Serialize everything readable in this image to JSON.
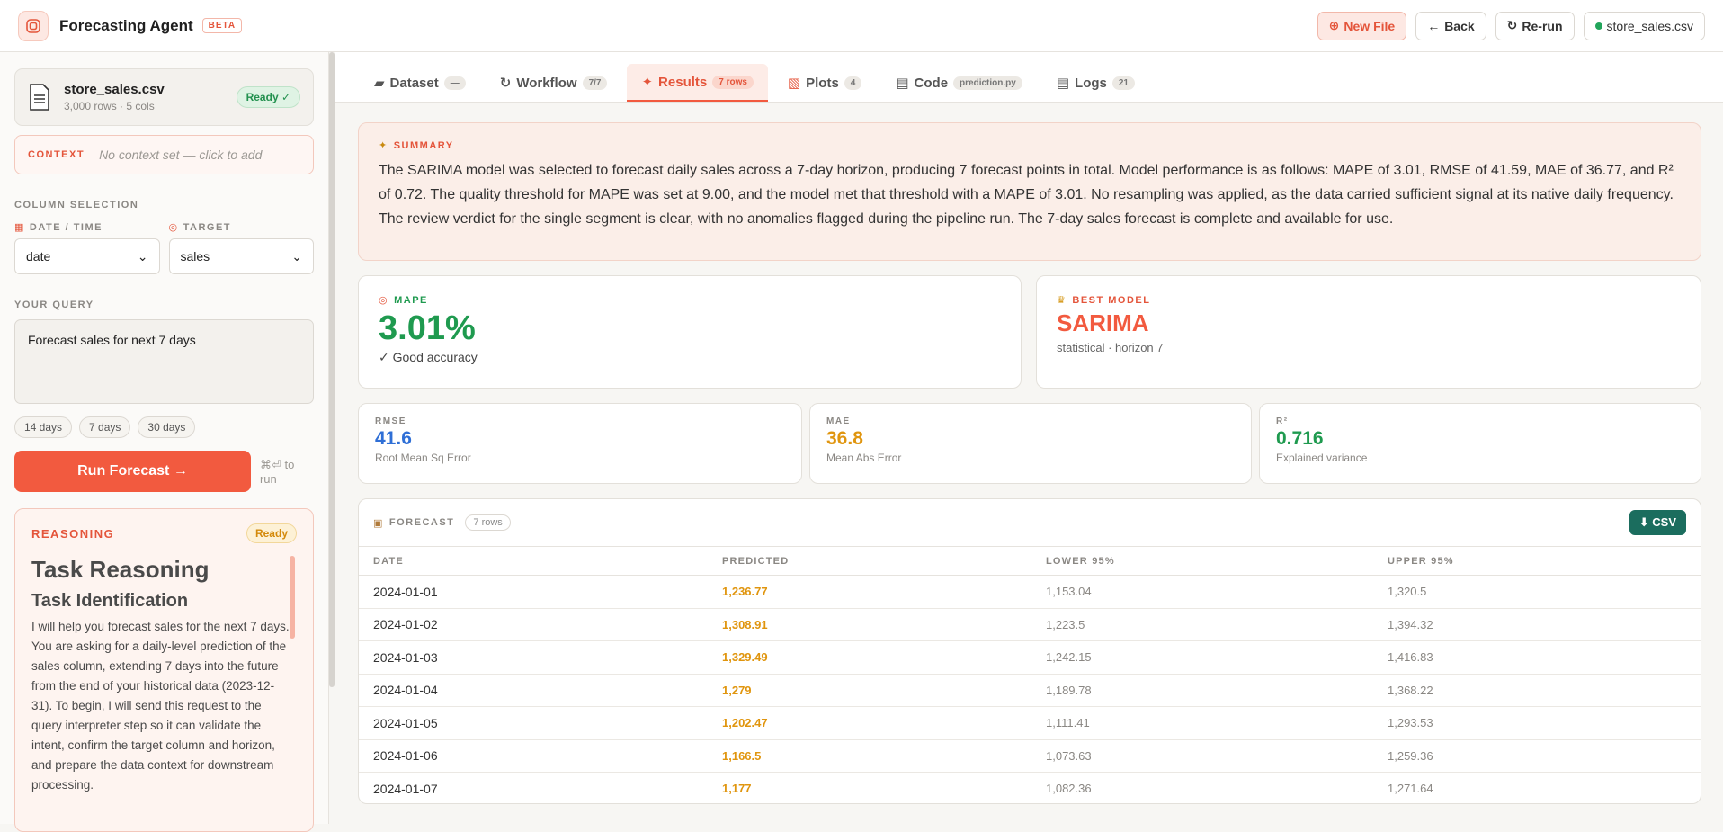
{
  "app": {
    "title": "Forecasting Agent",
    "badge": "BETA",
    "actions": {
      "new_file": "New File",
      "back": "Back",
      "rerun": "Re-run",
      "file": "store_sales.csv"
    }
  },
  "sidebar": {
    "file": {
      "name": "store_sales.csv",
      "meta": "3,000 rows · 5 cols",
      "status": "Ready ✓"
    },
    "context": {
      "label": "CONTEXT",
      "placeholder": "No context set — click to add"
    },
    "column_selection": {
      "label": "COLUMN SELECTION",
      "date_label": "DATE / TIME",
      "date_value": "date",
      "target_label": "TARGET",
      "target_value": "sales"
    },
    "query": {
      "label": "YOUR QUERY",
      "value": "Forecast sales for next 7 days",
      "chips": [
        "14 days",
        "7 days",
        "30 days"
      ]
    },
    "run": {
      "label": "Run Forecast →",
      "hint": "⌘⏎ to run"
    },
    "reasoning": {
      "label": "REASONING",
      "status": "Ready",
      "title": "Task Reasoning",
      "subtitle": "Task Identification",
      "body": "I will help you forecast sales for the next 7 days. You are asking for a daily-level prediction of the sales column, extending 7 days into the future from the end of your historical data (2023-12-31). To begin, I will send this request to the query interpreter step so it can validate the intent, confirm the target column and horizon, and prepare the data context for downstream processing."
    }
  },
  "tabs": [
    {
      "label": "Dataset",
      "count": "—"
    },
    {
      "label": "Workflow",
      "count": "7/7"
    },
    {
      "label": "Results",
      "count": "7 rows"
    },
    {
      "label": "Plots",
      "count": "4"
    },
    {
      "label": "Code",
      "count": "prediction.py"
    },
    {
      "label": "Logs",
      "count": "21"
    }
  ],
  "summary": {
    "label": "SUMMARY",
    "text": "The SARIMA model was selected to forecast daily sales across a 7-day horizon, producing 7 forecast points in total. Model performance is as follows: MAPE of 3.01, RMSE of 41.59, MAE of 36.77, and R² of 0.72. The quality threshold for MAPE was set at 9.00, and the model met that threshold with a MAPE of 3.01. No resampling was applied, as the data carried sufficient signal at its native daily frequency. The review verdict for the single segment is clear, with no anomalies flagged during the pipeline run. The 7-day sales forecast is complete and available for use."
  },
  "metrics": {
    "mape": {
      "label": "MAPE",
      "value": "3.01%",
      "note": "✓ Good accuracy"
    },
    "best_model": {
      "label": "BEST MODEL",
      "value": "SARIMA",
      "note": "statistical · horizon 7"
    },
    "rmse": {
      "label": "RMSE",
      "value": "41.6",
      "note": "Root Mean Sq Error"
    },
    "mae": {
      "label": "MAE",
      "value": "36.8",
      "note": "Mean Abs Error"
    },
    "r2": {
      "label": "R²",
      "value": "0.716",
      "note": "Explained variance"
    }
  },
  "forecast": {
    "label": "FORECAST",
    "count": "7 rows",
    "csv": "⬇ CSV",
    "columns": [
      "DATE",
      "PREDICTED",
      "LOWER 95%",
      "UPPER 95%"
    ],
    "rows": [
      [
        "2024-01-01",
        "1,236.77",
        "1,153.04",
        "1,320.5"
      ],
      [
        "2024-01-02",
        "1,308.91",
        "1,223.5",
        "1,394.32"
      ],
      [
        "2024-01-03",
        "1,329.49",
        "1,242.15",
        "1,416.83"
      ],
      [
        "2024-01-04",
        "1,279",
        "1,189.78",
        "1,368.22"
      ],
      [
        "2024-01-05",
        "1,202.47",
        "1,111.41",
        "1,293.53"
      ],
      [
        "2024-01-06",
        "1,166.5",
        "1,073.63",
        "1,259.36"
      ],
      [
        "2024-01-07",
        "1,177",
        "1,082.36",
        "1,271.64"
      ]
    ]
  },
  "colors": {
    "accent": "#f25a3f",
    "success": "#1f9a4f",
    "rmse": "#2f6fd6",
    "mae": "#e0950e",
    "csv": "#1b6d5e"
  }
}
